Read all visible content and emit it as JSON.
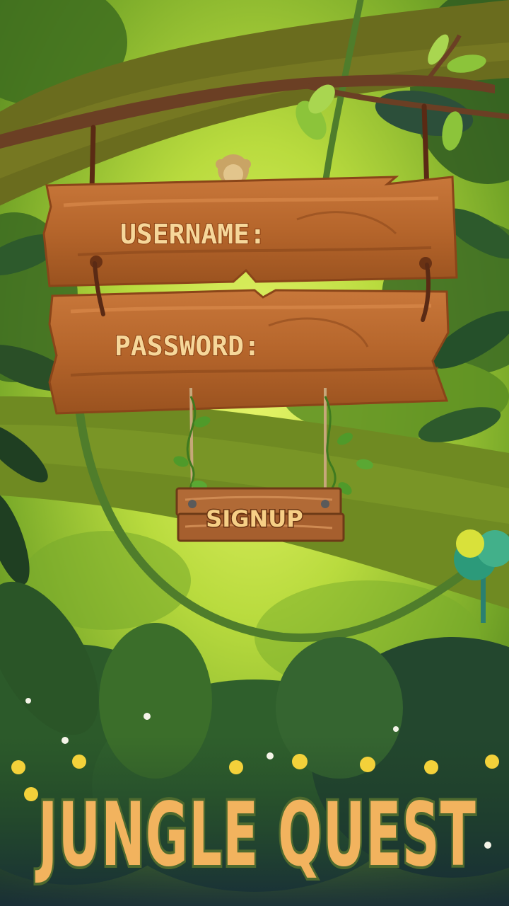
{
  "game": {
    "title": "JUNGLE QUEST"
  },
  "login_form": {
    "username_label": "USERNAME:",
    "username_value": "",
    "password_label": "PASSWORD:",
    "password_value": "",
    "signup_label": "SIGNUP"
  },
  "colors": {
    "jungle_green": "#8fc43a",
    "wood_brown": "#b5652b",
    "label_cream": "#f6d79a",
    "title_orange": "#f2b35e",
    "title_outline": "#4e6a2e"
  }
}
